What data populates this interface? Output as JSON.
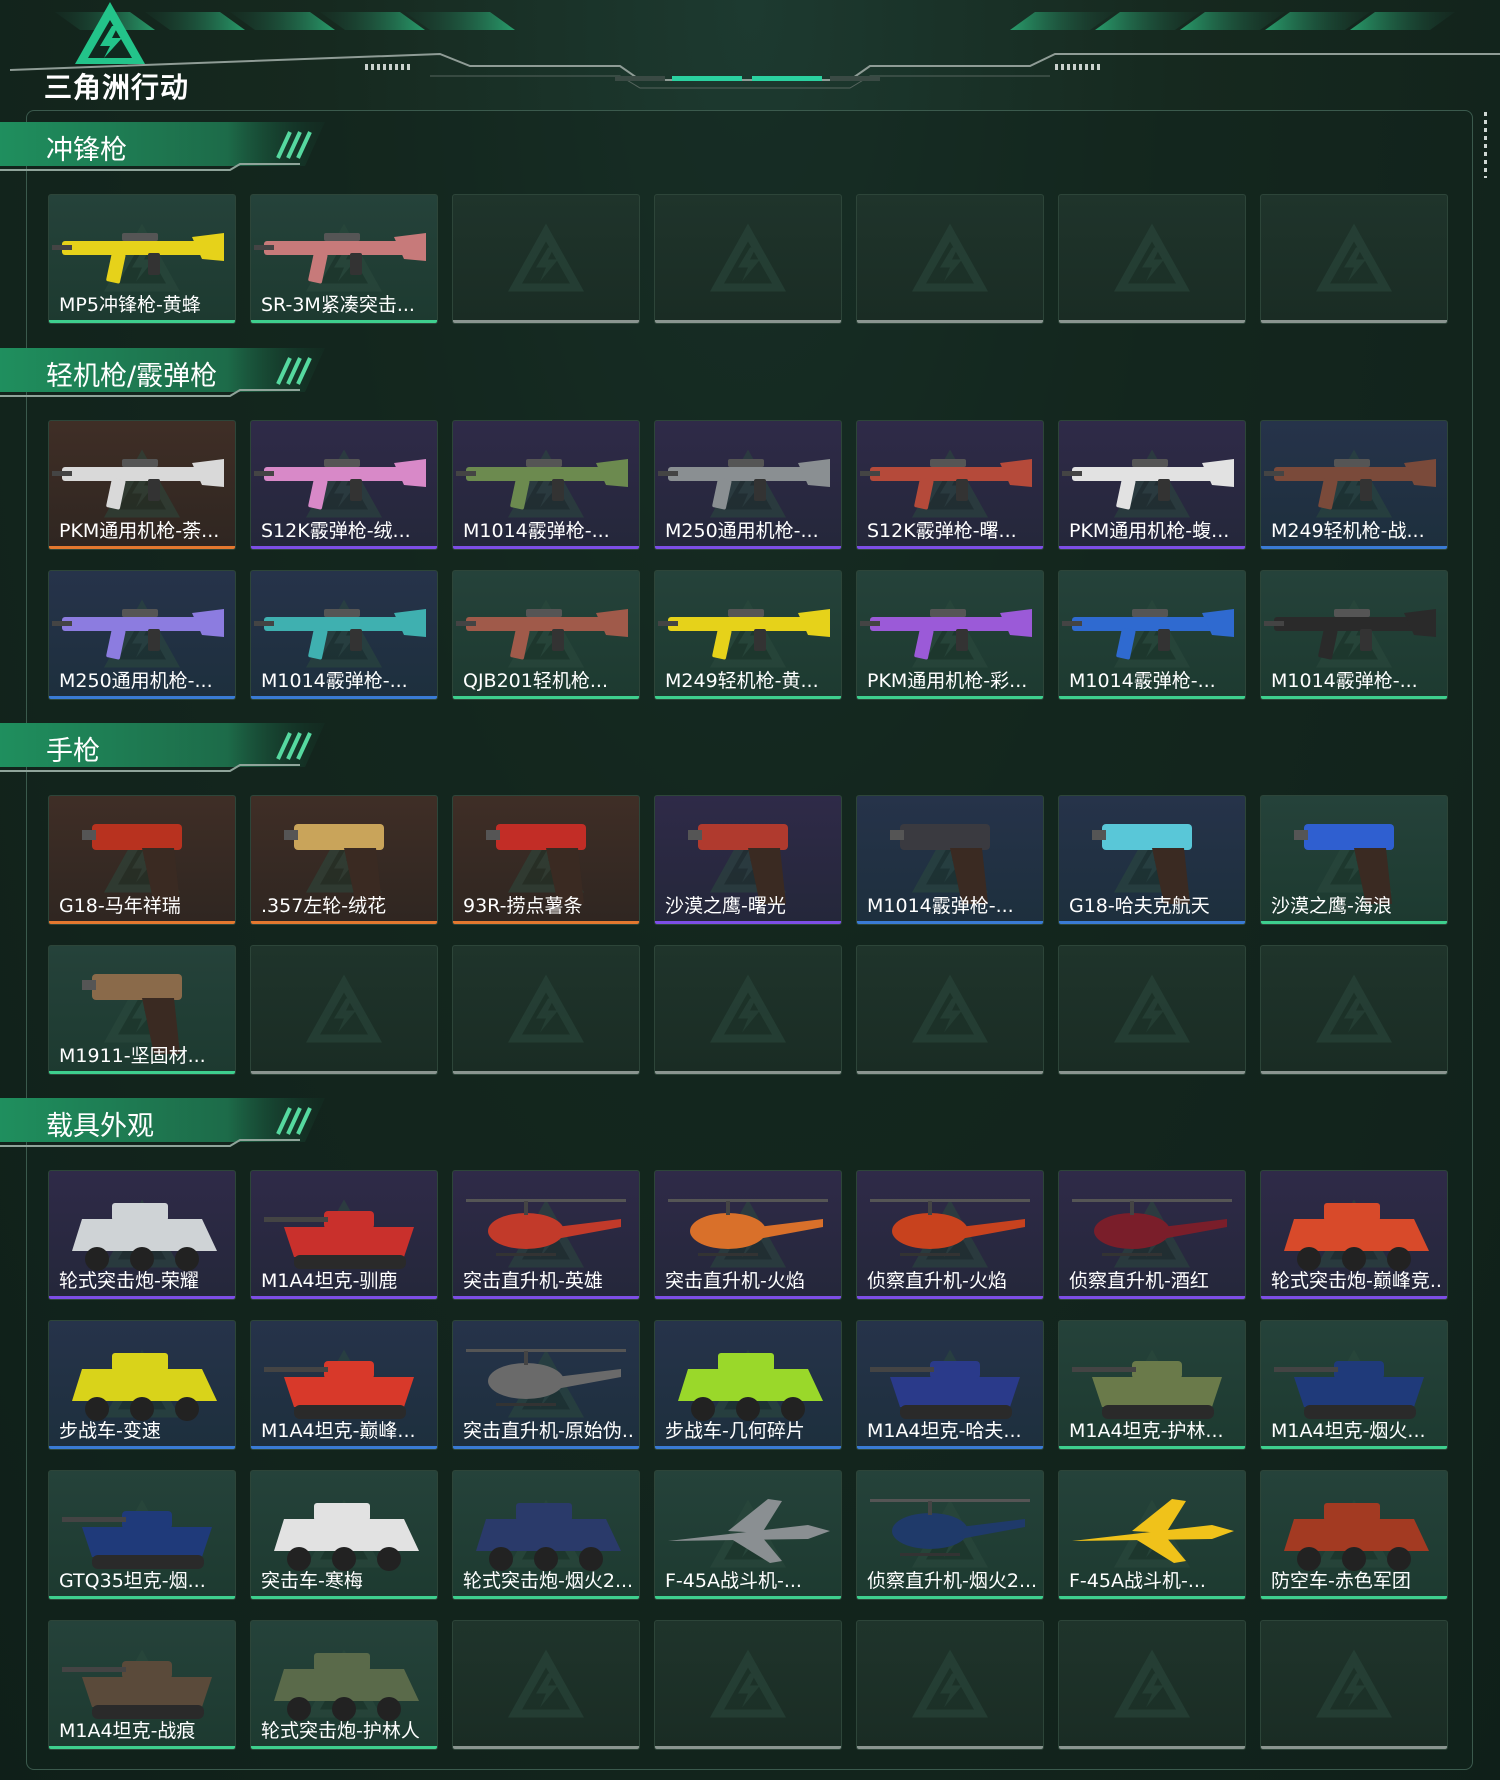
{
  "app": {
    "logo_text": "三角洲行动"
  },
  "colors": {
    "green": "#3ecf8e",
    "blue": "#3a7bd5",
    "purple": "#7d4ee6",
    "orange": "#e4782f",
    "empty": "#8a9590"
  },
  "sections": [
    {
      "title": "冲锋枪",
      "rows": [
        [
          {
            "label": "MP5冲锋枪-黄蜂",
            "quality": "green",
            "icon": "rifle-icon",
            "tint": "#e6d21a"
          },
          {
            "label": "SR-3M紧凑突击...",
            "quality": "green",
            "icon": "rifle-icon",
            "tint": "#c77a7a"
          },
          {
            "empty": true
          },
          {
            "empty": true
          },
          {
            "empty": true
          },
          {
            "empty": true
          },
          {
            "empty": true
          }
        ]
      ]
    },
    {
      "title": "轻机枪/霰弹枪",
      "rows": [
        [
          {
            "label": "PKM通用机枪-荼...",
            "quality": "orange",
            "icon": "rifle-icon",
            "tint": "#d9d9d9"
          },
          {
            "label": "S12K霰弹枪-绒...",
            "quality": "purple",
            "icon": "rifle-icon",
            "tint": "#d889c8"
          },
          {
            "label": "M1014霰弹枪-...",
            "quality": "purple",
            "icon": "rifle-icon",
            "tint": "#6c8a4f"
          },
          {
            "label": "M250通用机枪-...",
            "quality": "purple",
            "icon": "rifle-icon",
            "tint": "#8a8f92"
          },
          {
            "label": "S12K霰弹枪-曙...",
            "quality": "purple",
            "icon": "rifle-icon",
            "tint": "#b54a3a"
          },
          {
            "label": "PKM通用机枪-蝮...",
            "quality": "purple",
            "icon": "rifle-icon",
            "tint": "#e2e2e2"
          },
          {
            "label": "M249轻机枪-战...",
            "quality": "blue",
            "icon": "rifle-icon",
            "tint": "#7a4a3a"
          }
        ],
        [
          {
            "label": "M250通用机枪-...",
            "quality": "blue",
            "icon": "rifle-icon",
            "tint": "#8c7ce0"
          },
          {
            "label": "M1014霰弹枪-...",
            "quality": "blue",
            "icon": "rifle-icon",
            "tint": "#3fb0b0"
          },
          {
            "label": "QJB201轻机枪...",
            "quality": "green",
            "icon": "rifle-icon",
            "tint": "#a05a4a"
          },
          {
            "label": "M249轻机枪-黄...",
            "quality": "green",
            "icon": "rifle-icon",
            "tint": "#e6d21a"
          },
          {
            "label": "PKM通用机枪-彩...",
            "quality": "green",
            "icon": "rifle-icon",
            "tint": "#9b5ad8"
          },
          {
            "label": "M1014霰弹枪-...",
            "quality": "green",
            "icon": "rifle-icon",
            "tint": "#2f6ad0"
          },
          {
            "label": "M1014霰弹枪-...",
            "quality": "green",
            "icon": "rifle-icon",
            "tint": "#2a2a2a"
          }
        ]
      ]
    },
    {
      "title": "手枪",
      "rows": [
        [
          {
            "label": "G18-马年祥瑞",
            "quality": "orange",
            "icon": "pistol-icon",
            "tint": "#b8321f"
          },
          {
            "label": ".357左轮-绒花",
            "quality": "orange",
            "icon": "pistol-icon",
            "tint": "#c9a45a"
          },
          {
            "label": "93R-捞点薯条",
            "quality": "orange",
            "icon": "pistol-icon",
            "tint": "#c22d26"
          },
          {
            "label": "沙漠之鹰-曙光",
            "quality": "purple",
            "icon": "pistol-icon",
            "tint": "#b03a2e"
          },
          {
            "label": "M1014霰弹枪-...",
            "quality": "blue",
            "icon": "pistol-icon",
            "tint": "#3a3a40"
          },
          {
            "label": "G18-哈夫克航天",
            "quality": "blue",
            "icon": "pistol-icon",
            "tint": "#59c7d8"
          },
          {
            "label": "沙漠之鹰-海浪",
            "quality": "green",
            "icon": "pistol-icon",
            "tint": "#2f5fd0"
          }
        ],
        [
          {
            "label": "M1911-坚固材...",
            "quality": "green",
            "icon": "pistol-icon",
            "tint": "#8a6a4a"
          },
          {
            "empty": true
          },
          {
            "empty": true
          },
          {
            "empty": true
          },
          {
            "empty": true
          },
          {
            "empty": true
          },
          {
            "empty": true
          }
        ]
      ]
    },
    {
      "title": "载具外观",
      "rows": [
        [
          {
            "label": "轮式突击炮-荣耀",
            "quality": "purple",
            "icon": "armored-car-icon",
            "tint": "#cfd3d6"
          },
          {
            "label": "M1A4坦克-驯鹿",
            "quality": "purple",
            "icon": "tank-icon",
            "tint": "#c9302c"
          },
          {
            "label": "突击直升机-英雄",
            "quality": "purple",
            "icon": "helicopter-icon",
            "tint": "#c23a2a"
          },
          {
            "label": "突击直升机-火焰",
            "quality": "purple",
            "icon": "helicopter-icon",
            "tint": "#d9702a"
          },
          {
            "label": "侦察直升机-火焰",
            "quality": "purple",
            "icon": "helicopter-icon",
            "tint": "#c8421e"
          },
          {
            "label": "侦察直升机-酒红",
            "quality": "purple",
            "icon": "helicopter-icon",
            "tint": "#7a1e2a"
          },
          {
            "label": "轮式突击炮-巅峰竞...",
            "quality": "purple",
            "icon": "armored-car-icon",
            "tint": "#d84a2a"
          }
        ],
        [
          {
            "label": "步战车-变速",
            "quality": "blue",
            "icon": "armored-car-icon",
            "tint": "#d9d31a"
          },
          {
            "label": "M1A4坦克-巅峰...",
            "quality": "blue",
            "icon": "tank-icon",
            "tint": "#d8392a"
          },
          {
            "label": "突击直升机-原始伪...",
            "quality": "blue",
            "icon": "helicopter-icon",
            "tint": "#6a6a6a"
          },
          {
            "label": "步战车-几何碎片",
            "quality": "blue",
            "icon": "armored-car-icon",
            "tint": "#9ad82a"
          },
          {
            "label": "M1A4坦克-哈夫...",
            "quality": "blue",
            "icon": "tank-icon",
            "tint": "#2a3a8a"
          },
          {
            "label": "M1A4坦克-护林...",
            "quality": "green",
            "icon": "tank-icon",
            "tint": "#6a7a4a"
          },
          {
            "label": "M1A4坦克-烟火...",
            "quality": "green",
            "icon": "tank-icon",
            "tint": "#1f3a7a"
          }
        ],
        [
          {
            "label": "GTQ35坦克-烟...",
            "quality": "green",
            "icon": "tank-icon",
            "tint": "#1f3a7a"
          },
          {
            "label": "突击车-寒梅",
            "quality": "green",
            "icon": "armored-car-icon",
            "tint": "#e2e2e2"
          },
          {
            "label": "轮式突击炮-烟火2...",
            "quality": "green",
            "icon": "armored-car-icon",
            "tint": "#2a3a6a"
          },
          {
            "label": "F-45A战斗机-...",
            "quality": "green",
            "icon": "jet-icon",
            "tint": "#8a8f92"
          },
          {
            "label": "侦察直升机-烟火2...",
            "quality": "green",
            "icon": "helicopter-icon",
            "tint": "#1f3a6a"
          },
          {
            "label": "F-45A战斗机-...",
            "quality": "green",
            "icon": "jet-icon",
            "tint": "#f0c21a"
          },
          {
            "label": "防空车-赤色军团",
            "quality": "green",
            "icon": "armored-car-icon",
            "tint": "#a33a22"
          }
        ],
        [
          {
            "label": "M1A4坦克-战痕",
            "quality": "green",
            "icon": "tank-icon",
            "tint": "#5a4a3a"
          },
          {
            "label": "轮式突击炮-护林人",
            "quality": "green",
            "icon": "armored-car-icon",
            "tint": "#5a6a4a"
          },
          {
            "empty": true
          },
          {
            "empty": true
          },
          {
            "empty": true
          },
          {
            "empty": true
          },
          {
            "empty": true
          }
        ]
      ]
    }
  ]
}
